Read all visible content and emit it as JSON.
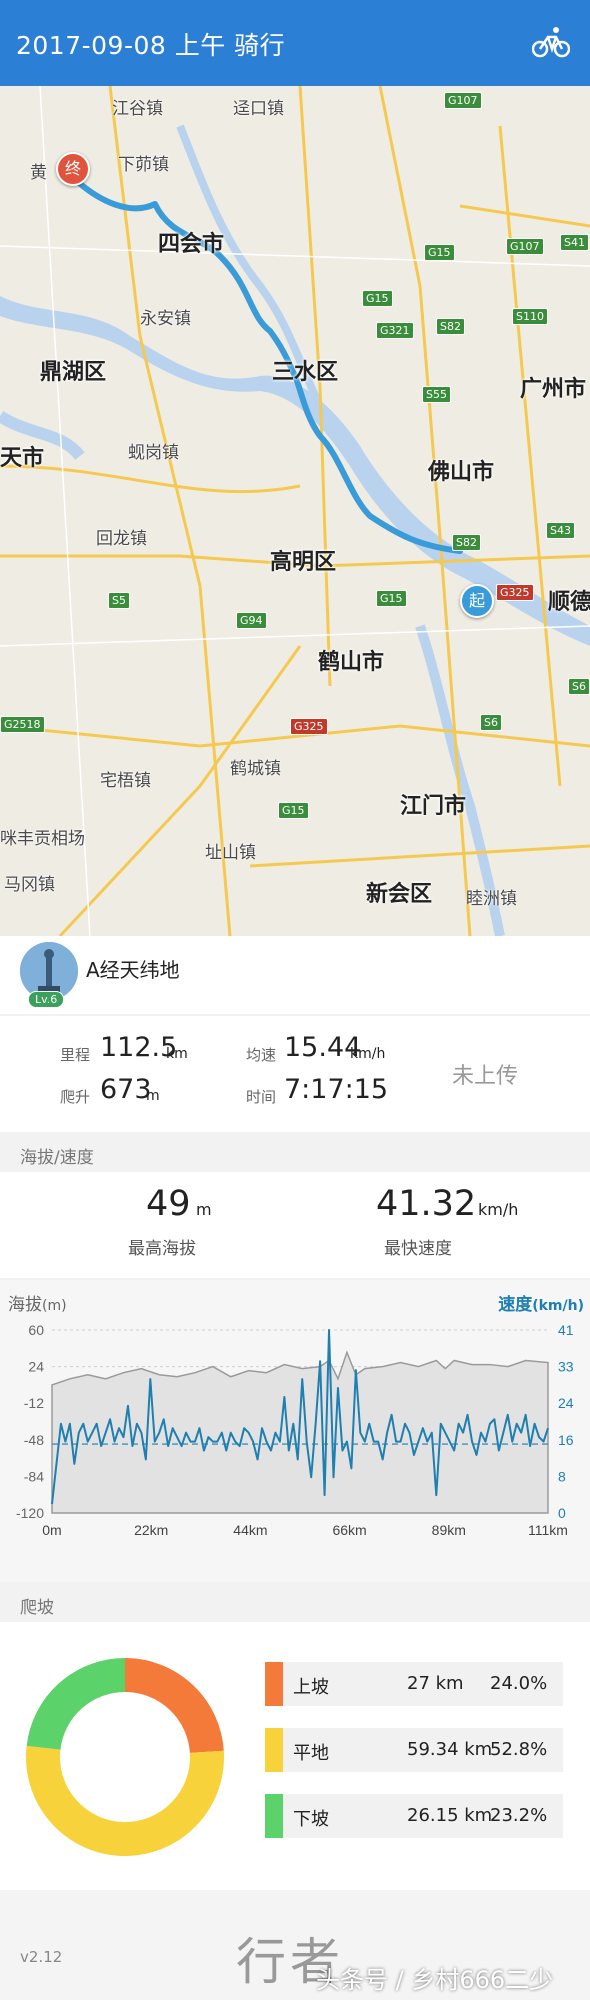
{
  "header": {
    "title": "2017-09-08 上午 骑行",
    "bike_icon": "bicycle-icon"
  },
  "map": {
    "places": [
      "江谷镇",
      "迳口镇",
      "下茆镇",
      "黄",
      "四会市",
      "永安镇",
      "鼎湖区",
      "三水区",
      "广州市",
      "佛山市",
      "蚬岗镇",
      "回龙镇",
      "高明区",
      "顺德",
      "鹤山市",
      "宅梧镇",
      "鹤城镇",
      "江门市",
      "址山镇",
      "新会区",
      "睦洲镇",
      "马冈镇",
      "天市",
      "咪丰贡相场"
    ],
    "shields": [
      "G107",
      "G15",
      "G107",
      "S41",
      "G15",
      "S110",
      "G321",
      "S82",
      "S55",
      "S82",
      "G325",
      "S43",
      "G15",
      "S5",
      "G94",
      "G325",
      "G2518",
      "S6",
      "G15",
      "S6"
    ],
    "start_label": "起",
    "end_label": "终",
    "route_color": "#3a9bd9"
  },
  "user": {
    "name": "A经天纬地",
    "level": "Lv.6"
  },
  "stats": {
    "distance_label": "里程",
    "distance": "112.5",
    "distance_unit": "km",
    "climb_label": "爬升",
    "climb": "673",
    "climb_unit": "m",
    "avg_label": "均速",
    "avg": "15.44",
    "avg_unit": "km/h",
    "time_label": "时间",
    "time": "7:17:15",
    "upload": "未上传"
  },
  "altitude_speed": {
    "section_title": "海拔/速度",
    "max_alt": "49",
    "max_alt_unit": "m",
    "max_alt_label": "最高海拔",
    "max_speed": "41.32",
    "max_speed_unit": "km/h",
    "max_speed_label": "最快速度"
  },
  "chart_labels": {
    "left_title": "海拔",
    "left_unit": "(m)",
    "right_title": "速度",
    "right_unit": "(km/h)"
  },
  "chart_data": {
    "type": "line",
    "xlabel": "",
    "ylabel": "海拔(m)",
    "y2label": "速度(km/h)",
    "x_ticks": [
      "0m",
      "22km",
      "44km",
      "66km",
      "89km",
      "111km"
    ],
    "y_ticks": [
      "60",
      "24",
      "-12",
      "-48",
      "-84",
      "-120"
    ],
    "y2_ticks": [
      "41",
      "33",
      "24",
      "16",
      "8",
      "0"
    ],
    "ylim": [
      -120,
      60
    ],
    "y2lim": [
      0,
      41
    ],
    "xlim": [
      0,
      111
    ],
    "avg_speed": 15.44,
    "series": [
      {
        "name": "海拔",
        "axis": "left",
        "color": "#9a9a9a",
        "x": [
          0,
          4,
          8,
          12,
          16,
          20,
          24,
          28,
          32,
          36,
          40,
          44,
          48,
          52,
          56,
          60,
          62,
          64,
          66,
          68,
          70,
          74,
          78,
          82,
          86,
          88,
          90,
          94,
          98,
          102,
          106,
          111
        ],
        "y": [
          6,
          12,
          16,
          12,
          18,
          22,
          16,
          14,
          18,
          24,
          14,
          20,
          18,
          26,
          22,
          24,
          30,
          12,
          38,
          16,
          22,
          24,
          28,
          24,
          30,
          22,
          30,
          26,
          26,
          24,
          30,
          28
        ]
      },
      {
        "name": "速度",
        "axis": "right",
        "color": "#1e7fb0",
        "x": [
          0,
          2,
          3,
          4,
          5,
          6,
          7,
          8,
          9,
          10,
          11,
          12,
          13,
          14,
          15,
          16,
          17,
          18,
          19,
          20,
          21,
          22,
          23,
          24,
          25,
          26,
          27,
          28,
          29,
          30,
          31,
          32,
          33,
          34,
          35,
          36,
          37,
          38,
          39,
          40,
          41,
          42,
          43,
          44,
          45,
          46,
          47,
          48,
          49,
          50,
          51,
          52,
          53,
          54,
          55,
          56,
          57,
          58,
          59,
          60,
          61,
          62,
          63,
          64,
          65,
          66,
          67,
          68,
          69,
          70,
          71,
          72,
          73,
          74,
          75,
          76,
          77,
          78,
          79,
          80,
          81,
          82,
          83,
          84,
          85,
          86,
          87,
          88,
          89,
          90,
          91,
          92,
          93,
          94,
          95,
          96,
          97,
          98,
          99,
          100,
          101,
          102,
          103,
          104,
          105,
          106,
          107,
          108,
          109,
          110,
          111
        ],
        "y": [
          2,
          20,
          16,
          20,
          11,
          18,
          20,
          16,
          18,
          20,
          15,
          18,
          21,
          16,
          19,
          17,
          24,
          15,
          20,
          18,
          12,
          30,
          16,
          18,
          21,
          15,
          19,
          17,
          15,
          18,
          16,
          16,
          19,
          14,
          17,
          16,
          16,
          18,
          14,
          18,
          16,
          15,
          19,
          18,
          16,
          12,
          19,
          16,
          14,
          18,
          16,
          26,
          14,
          20,
          12,
          30,
          16,
          8,
          20,
          34,
          4,
          41,
          8,
          28,
          14,
          16,
          10,
          32,
          18,
          16,
          20,
          16,
          16,
          12,
          18,
          22,
          16,
          16,
          20,
          18,
          13,
          16,
          19,
          16,
          18,
          4,
          20,
          18,
          16,
          14,
          20,
          18,
          22,
          16,
          13,
          18,
          16,
          20,
          21,
          14,
          18,
          22,
          16,
          20,
          18,
          22,
          15,
          20,
          17,
          16,
          19
        ]
      }
    ]
  },
  "climb": {
    "section_title": "爬坡",
    "items": [
      {
        "name": "上坡",
        "km": "27 km",
        "pct": "24.0%",
        "value": 24.0,
        "color": "#f47a3a"
      },
      {
        "name": "平地",
        "km": "59.34 km",
        "pct": "52.8%",
        "value": 52.8,
        "color": "#f7d23a"
      },
      {
        "name": "下坡",
        "km": "26.15 km",
        "pct": "23.2%",
        "value": 23.2,
        "color": "#5bd36a"
      }
    ]
  },
  "footer": {
    "version": "v2.12",
    "logo": "行者",
    "watermark": "头条号 / 乡村666二少"
  }
}
